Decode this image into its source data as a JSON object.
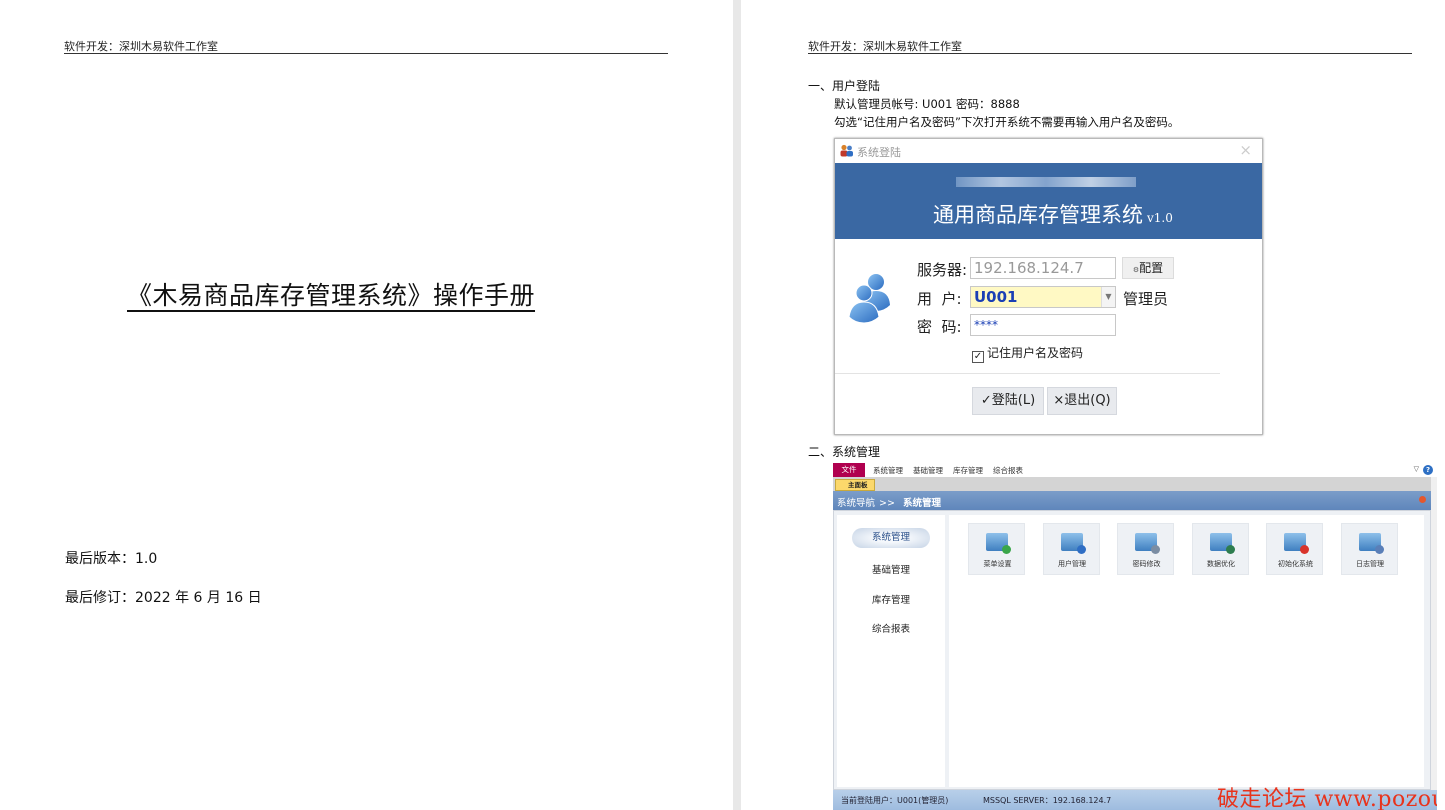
{
  "left_page": {
    "header": "软件开发：深圳木易软件工作室",
    "title": "《木易商品库存管理系统》操作手册",
    "version_line": "最后版本：1.0",
    "revision_line": "最后修订：2022 年 6 月 16 日"
  },
  "right_page": {
    "header": "软件开发：深圳木易软件工作室",
    "section1": {
      "heading": "一、用户登陆",
      "line1": "默认管理员帐号: U001 密码：8888",
      "line2": "勾选“记住用户名及密码”下次打开系统不需要再输入用户名及密码。"
    },
    "login_dialog": {
      "window_title": "系统登陆",
      "close": "×",
      "app_title": "通用商品库存管理系统",
      "version": "v1.0",
      "server_label": "服务器:",
      "server_value": "192.168.124.7",
      "config_button": "配置",
      "user_label": "用  户:",
      "user_value": "U001",
      "user_role": "管理员",
      "password_label": "密  码:",
      "password_value": "****",
      "remember_label": "记住用户名及密码",
      "remember_checked": true,
      "login_button": "✓登陆(L)",
      "exit_button": "×退出(Q)"
    },
    "section2": {
      "heading": "二、系统管理"
    },
    "main_window": {
      "menu": {
        "file": "文件",
        "items": [
          "系统管理",
          "基础管理",
          "库存管理",
          "综合报表"
        ]
      },
      "tab": "主面板",
      "breadcrumb_root": "系统导航",
      "breadcrumb_sep": ">>",
      "breadcrumb_current": "系统管理",
      "sidebar": [
        "系统管理",
        "基础管理",
        "库存管理",
        "综合报表"
      ],
      "sidebar_active": "系统管理",
      "tiles": [
        {
          "label": "菜单设置",
          "badge_color": "#3aa64a"
        },
        {
          "label": "用户管理",
          "badge_color": "#2f6ec4"
        },
        {
          "label": "密码修改",
          "badge_color": "#7b8da3"
        },
        {
          "label": "数据优化",
          "badge_color": "#2e7d4f"
        },
        {
          "label": "初始化系统",
          "badge_color": "#d9342b"
        },
        {
          "label": "日志管理",
          "badge_color": "#5a7fb8"
        }
      ],
      "status": {
        "user": "当前登陆用户：U001(管理员)",
        "server": "MSSQL SERVER：192.168.124.7"
      },
      "watermark": "破走论坛 www.pozou.com",
      "colors": {
        "file_menu": "#b0004f",
        "nav_bar": "#6a8fc1",
        "banner": "#3a68a3"
      }
    }
  }
}
